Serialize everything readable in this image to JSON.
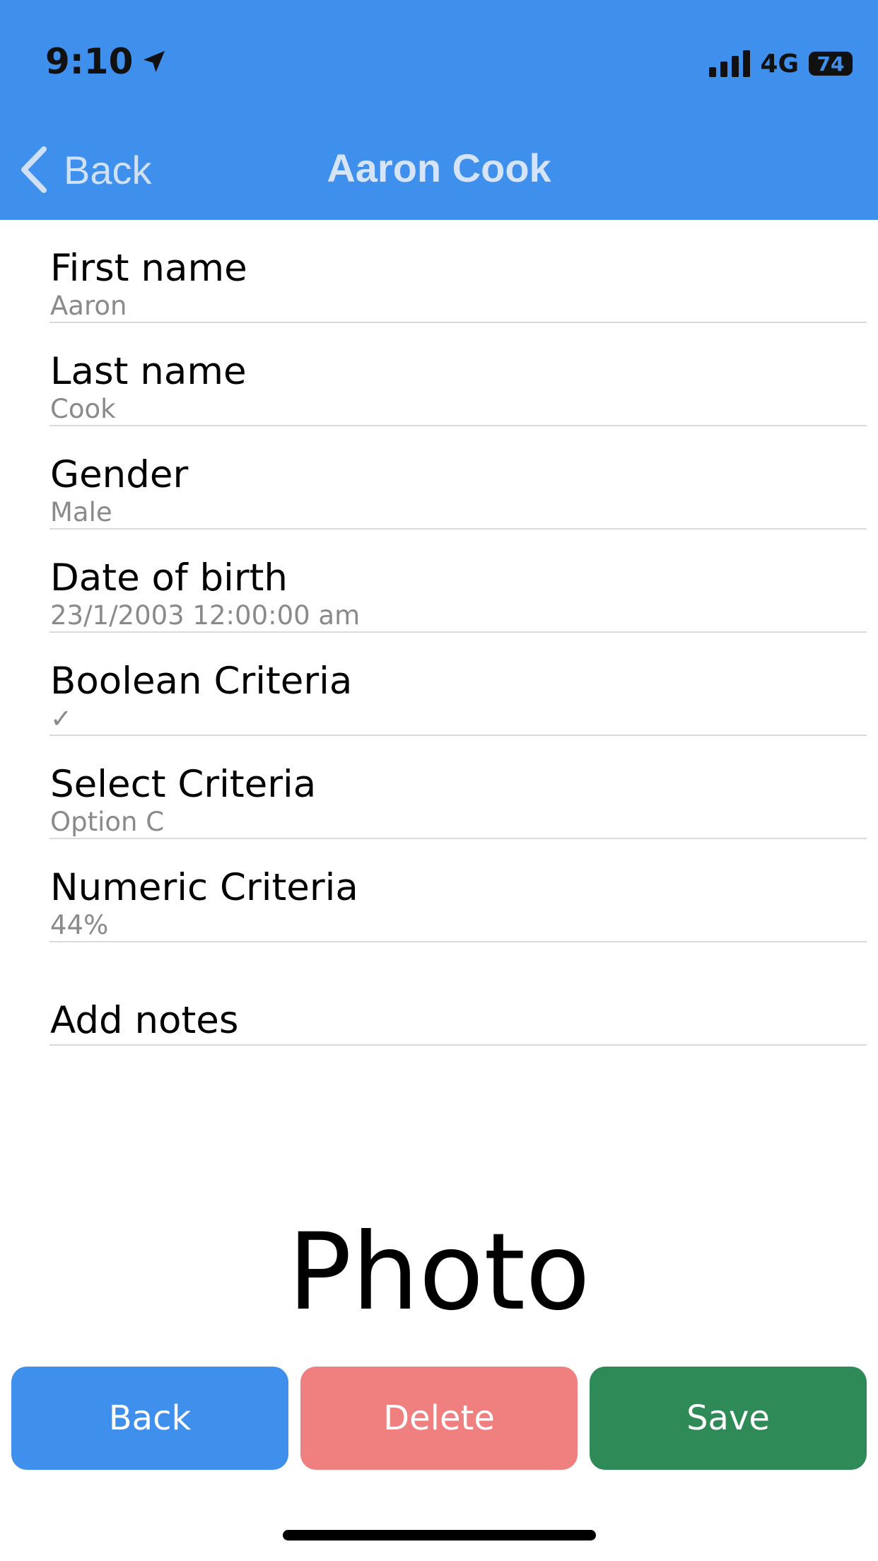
{
  "status_bar": {
    "time": "9:10",
    "network": "4G",
    "battery": "74"
  },
  "nav": {
    "back_label": "Back",
    "title": "Aaron Cook"
  },
  "fields": [
    {
      "label": "First name",
      "value": "Aaron"
    },
    {
      "label": "Last name",
      "value": "Cook"
    },
    {
      "label": "Gender",
      "value": "Male"
    },
    {
      "label": "Date of birth",
      "value": "23/1/2003 12:00:00 am"
    },
    {
      "label": "Boolean Criteria",
      "value": "✓"
    },
    {
      "label": "Select Criteria",
      "value": "Option C"
    },
    {
      "label": "Numeric Criteria",
      "value": "44%"
    }
  ],
  "notes": {
    "label": "Add notes"
  },
  "photo": {
    "label": "Photo"
  },
  "buttons": {
    "back": "Back",
    "delete": "Delete",
    "save": "Save"
  },
  "colors": {
    "header": "#3f8fec",
    "back_button": "#3f8fec",
    "delete_button": "#f07f7f",
    "save_button": "#2e8b57"
  }
}
